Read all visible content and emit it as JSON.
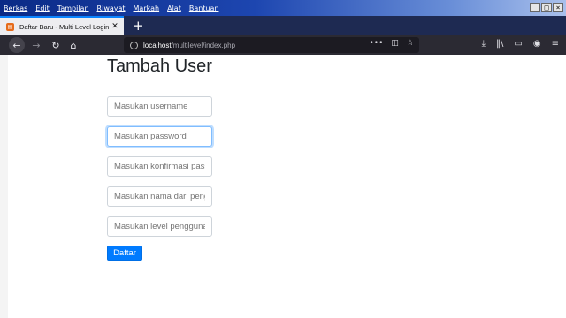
{
  "menubar": {
    "items": [
      "Berkas",
      "Edit",
      "Tampilan",
      "Riwayat",
      "Markah",
      "Alat",
      "Bantuan"
    ]
  },
  "tab": {
    "title": "Daftar Baru - Multi Level Login",
    "favicon": "page-icon"
  },
  "urlbar": {
    "host": "localhost",
    "path": "/multilevel/index.php"
  },
  "page": {
    "title": "Tambah User",
    "fields": [
      {
        "placeholder": "Masukan username"
      },
      {
        "placeholder": "Masukan password"
      },
      {
        "placeholder": "Masukan konfirmasi password"
      },
      {
        "placeholder": "Masukan nama dari pengguna"
      },
      {
        "placeholder": "Masukan level pengguna"
      }
    ],
    "submit_label": "Daftar"
  },
  "colors": {
    "accent": "#007bff",
    "menubar": "#0b2a86",
    "tabstrip": "#1e2a52",
    "navbar": "#2b2a33"
  }
}
